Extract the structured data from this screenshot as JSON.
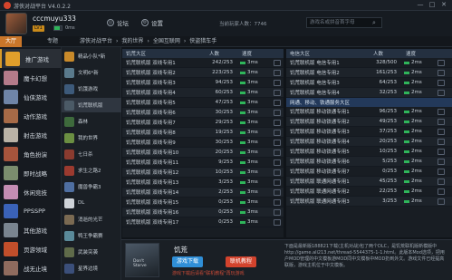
{
  "titlebar": {
    "title": "游侠对战平台 V4.0.2.2",
    "min": "—",
    "max": "□",
    "close": "✕"
  },
  "user": {
    "name": "cccmuyu333",
    "level": "LV1",
    "speed_text": "0ms"
  },
  "topnav": [
    {
      "label": "论坛",
      "icon": "forum-icon"
    },
    {
      "label": "设置",
      "icon": "gear-icon"
    }
  ],
  "online_text": "当前玩家人数：7746",
  "search": {
    "placeholder": "游戏名或拼音首字母"
  },
  "tabs": {
    "hall": "大厅",
    "favorite": "专题"
  },
  "breadcrumb": [
    "游侠对战平台",
    "我的世界",
    "全国互联网",
    "侠盗猎车手"
  ],
  "sidebar": [
    {
      "label": "推广游戏",
      "color": "#e09f2b"
    },
    {
      "label": "魔卡幻想",
      "color": "#b57b8a"
    },
    {
      "label": "仙侠游戏",
      "color": "#6f85a8"
    },
    {
      "label": "动作游戏",
      "color": "#a66a47"
    },
    {
      "label": "射击游戏",
      "color": "#b9b2a6"
    },
    {
      "label": "角色扮演",
      "color": "#a6543c"
    },
    {
      "label": "即时战略",
      "color": "#7b8d6e"
    },
    {
      "label": "休闲竞技",
      "color": "#c48db3"
    },
    {
      "label": "PPSSPP",
      "color": "#3a62b8"
    },
    {
      "label": "其他游戏",
      "color": "#7a8590"
    },
    {
      "label": "页游领域",
      "color": "#c24f2b"
    },
    {
      "label": "战无止境",
      "color": "#8f6b5e"
    }
  ],
  "games": [
    {
      "label": "精品小队*新",
      "color": "#c98a2a"
    },
    {
      "label": "文明6*新",
      "color": "#5a7a8c"
    },
    {
      "label": "饥饿游戏",
      "color": "#3d5a7a"
    },
    {
      "label": "饥荒联机版",
      "color": "#4b5a66"
    },
    {
      "label": "森林",
      "color": "#3e6a3c"
    },
    {
      "label": "我的世界",
      "color": "#6b8f42"
    },
    {
      "label": "七日杀",
      "color": "#8a3b2f"
    },
    {
      "label": "求生之路2",
      "color": "#9b3a2f"
    },
    {
      "label": "魔兽争霸3",
      "color": "#4f6fa1"
    },
    {
      "label": "DL",
      "color": "#cfd4d9"
    },
    {
      "label": "消逝的光芒",
      "color": "#7a6a52"
    },
    {
      "label": "鸭王争霸赛",
      "color": "#5a8a9a"
    },
    {
      "label": "武装突袭",
      "color": "#5f6b4a"
    },
    {
      "label": "星界边境",
      "color": "#3b4f7a"
    }
  ],
  "panel_headers": {
    "name_left": "饥荒大区",
    "name_right": "电信大区",
    "count": "人数",
    "speed": "速度"
  },
  "left_rows": [
    {
      "name": "饥荒联机版 双线专用1",
      "count": "242/253",
      "ms": "3ms"
    },
    {
      "name": "饥荒联机版 双线专用2",
      "count": "223/253",
      "ms": "3ms"
    },
    {
      "name": "饥荒联机版 双线专用3",
      "count": "94/253",
      "ms": "3ms"
    },
    {
      "name": "饥荒联机版 双线专用4",
      "count": "60/253",
      "ms": "3ms"
    },
    {
      "name": "饥荒联机版 双线专用5",
      "count": "47/253",
      "ms": "3ms"
    },
    {
      "name": "饥荒联机版 双线专用6",
      "count": "30/253",
      "ms": "3ms"
    },
    {
      "name": "饥荒联机版 双线专用7",
      "count": "29/253",
      "ms": "3ms"
    },
    {
      "name": "饥荒联机版 双线专用8",
      "count": "19/253",
      "ms": "3ms"
    },
    {
      "name": "饥荒联机版 双线专用9",
      "count": "30/253",
      "ms": "3ms"
    },
    {
      "name": "饥荒联机版 双线专用10",
      "count": "20/253",
      "ms": "3ms"
    },
    {
      "name": "饥荒联机版 双线专用11",
      "count": "9/253",
      "ms": "3ms"
    },
    {
      "name": "饥荒联机版 双线专用12",
      "count": "10/253",
      "ms": "3ms"
    },
    {
      "name": "饥荒联机版 双线专用13",
      "count": "3/253",
      "ms": "3ms"
    },
    {
      "name": "饥荒联机版 双线专用14",
      "count": "2/253",
      "ms": "3ms"
    },
    {
      "name": "饥荒联机版 双线专用15",
      "count": "0/253",
      "ms": "3ms"
    },
    {
      "name": "饥荒联机版 双线专用16",
      "count": "0/253",
      "ms": "3ms"
    },
    {
      "name": "饥荒联机版 双线专用17",
      "count": "0/253",
      "ms": "3ms"
    }
  ],
  "right_rows_a": [
    {
      "name": "饥荒联机版 电信专用1",
      "count": "328/500",
      "ms": "2ms"
    },
    {
      "name": "饥荒联机版 电信专用2",
      "count": "161/253",
      "ms": "2ms"
    },
    {
      "name": "饥荒联机版 电信专用3",
      "count": "64/253",
      "ms": "2ms"
    },
    {
      "name": "饥荒联机版 电信专用4",
      "count": "32/253",
      "ms": "2ms"
    }
  ],
  "subheader_right": "网通、移动、铁通服务大区",
  "right_rows_b": [
    {
      "name": "饥荒联机版 移动铁通专用1",
      "count": "96/253",
      "ms": "2ms"
    },
    {
      "name": "饥荒联机版 移动铁通专用2",
      "count": "49/253",
      "ms": "2ms"
    },
    {
      "name": "饥荒联机版 移动铁通专用3",
      "count": "37/253",
      "ms": "2ms"
    },
    {
      "name": "饥荒联机版 移动铁通专用4",
      "count": "20/253",
      "ms": "2ms"
    },
    {
      "name": "饥荒联机版 移动铁通专用5",
      "count": "10/253",
      "ms": "2ms"
    },
    {
      "name": "饥荒联机版 移动铁通专用6",
      "count": "5/253",
      "ms": "2ms"
    },
    {
      "name": "饥荒联机版 移动铁通专用7",
      "count": "0/253",
      "ms": "2ms"
    },
    {
      "name": "饥荒联机版 联通网通专用1",
      "count": "45/253",
      "ms": "2ms"
    },
    {
      "name": "饥荒联机版 联通网通专用2",
      "count": "22/253",
      "ms": "2ms"
    },
    {
      "name": "饥荒联机版 联通网通专用3",
      "count": "3/253",
      "ms": "2ms"
    }
  ],
  "banner": {
    "art_text": "Don't Starve",
    "game_name": "饥荒",
    "download": "游戏下载",
    "tutorial": "联机教程",
    "hint": "游戏下载后请看\"联机教程\"再玩游戏",
    "desc": "下面是最新版188821下载(主机对战)包了两个DLC，是饥荒联机版新模版中http://game.ali213.net/thread-5544375-1-1.html。此版本Mod选项，把用户MOD管理的中文模板游MOD同中文模板中MOD扔到外文。游戏文件已经提高联版，游戏主机位于中文模板。"
  }
}
